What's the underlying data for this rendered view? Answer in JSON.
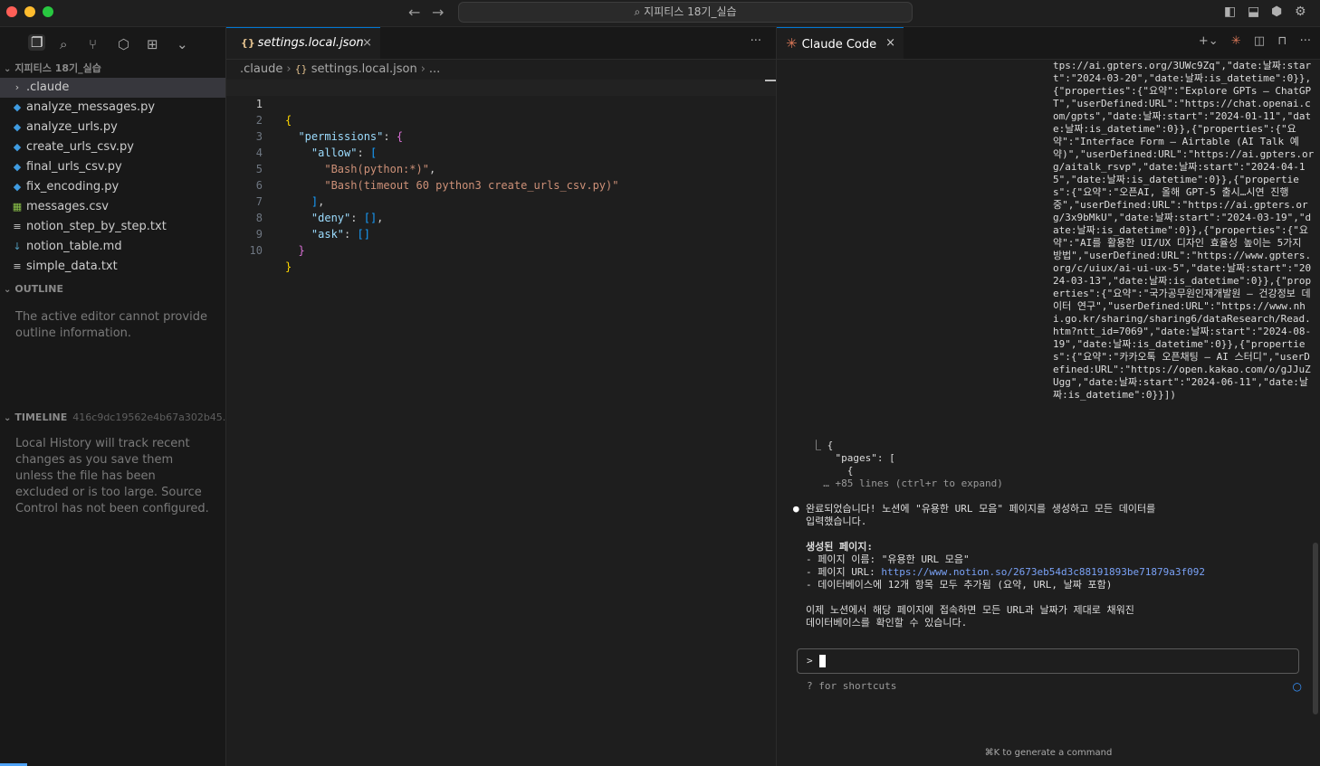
{
  "window": {
    "search_text": "지피티스 18기_실습"
  },
  "sidebar": {
    "explorer_title": "지피티스 18기_실습",
    "files": [
      {
        "name": ".claude",
        "type": "folder"
      },
      {
        "name": "analyze_messages.py",
        "type": "py"
      },
      {
        "name": "analyze_urls.py",
        "type": "py"
      },
      {
        "name": "create_urls_csv.py",
        "type": "py"
      },
      {
        "name": "final_urls_csv.py",
        "type": "py"
      },
      {
        "name": "fix_encoding.py",
        "type": "py"
      },
      {
        "name": "messages.csv",
        "type": "csv"
      },
      {
        "name": "notion_step_by_step.txt",
        "type": "txt"
      },
      {
        "name": "notion_table.md",
        "type": "md"
      },
      {
        "name": "simple_data.txt",
        "type": "txt"
      }
    ],
    "outline_title": "OUTLINE",
    "outline_message": "The active editor cannot provide outline information.",
    "timeline_title": "TIMELINE",
    "timeline_hash": "416c9dc19562e4b67a302b45...",
    "timeline_message": "Local History will track recent changes as you save them unless the file has been excluded or is too large. Source Control has not been configured."
  },
  "editor": {
    "tab_label": "settings.local.json",
    "breadcrumb": {
      "folder": ".claude",
      "file": "settings.local.json",
      "more": "..."
    },
    "lines": [
      "{",
      "  \"permissions\": {",
      "    \"allow\": [",
      "      \"Bash(python:*)\",",
      "      \"Bash(timeout 60 python3 create_urls_csv.py)\"",
      "    ],",
      "    \"deny\": [],",
      "    \"ask\": []",
      "  }",
      "}"
    ],
    "line_numbers": [
      "1",
      "2",
      "3",
      "4",
      "5",
      "6",
      "7",
      "8",
      "9",
      "10"
    ],
    "code": {
      "l2_key": "\"permissions\"",
      "l3_key": "\"allow\"",
      "l4_str": "\"Bash(python:*)\"",
      "l5_str": "\"Bash(timeout 60 python3 create_urls_csv.py)\"",
      "l7_key": "\"deny\"",
      "l8_key": "\"ask\""
    }
  },
  "claude": {
    "tab_label": "Claude Code",
    "json_dump": "tps://ai.gpters.org/3UWc9Zq\",\"date:날짜:start\":\"2024-03-20\",\"date:날짜:is_datetime\":0}},{\"properties\":{\"요약\":\"Explore GPTs – ChatGPT\",\"userDefined:URL\":\"https://chat.openai.com/gpts\",\"date:날짜:start\":\"2024-01-11\",\"date:날짜:is_datetime\":0}},{\"properties\":{\"요약\":\"Interface Form – Airtable (AI Talk 예약)\",\"userDefined:URL\":\"https://ai.gpters.org/aitalk_rsvp\",\"date:날짜:start\":\"2024-04-15\",\"date:날짜:is_datetime\":0}},{\"properties\":{\"요약\":\"오픈AI, 올해 GPT-5 출시…시연 진행 중\",\"userDefined:URL\":\"https://ai.gpters.org/3x9bMkU\",\"date:날짜:start\":\"2024-03-19\",\"date:날짜:is_datetime\":0}},{\"properties\":{\"요약\":\"AI를 활용한 UI/UX 디자인 효율성 높이는 5가지 방법\",\"userDefined:URL\":\"https://www.gpters.org/c/uiux/ai-ui-ux-5\",\"date:날짜:start\":\"2024-03-13\",\"date:날짜:is_datetime\":0}},{\"properties\":{\"요약\":\"국가공무원인재개발원 – 건강정보 데이터 연구\",\"userDefined:URL\":\"https://www.nhi.go.kr/sharing/sharing6/dataResearch/Read.htm?ntt_id=7069\",\"date:날짜:start\":\"2024-08-19\",\"date:날짜:is_datetime\":0}},{\"properties\":{\"요약\":\"카카오톡 오픈채팅 – AI 스터디\",\"userDefined:URL\":\"https://open.kakao.com/o/gJJuZUgg\",\"date:날짜:start\":\"2024-06-11\",\"date:날짜:is_datetime\":0}}])",
    "result_line1": "⎿ {",
    "result_line2": "    \"pages\": [",
    "result_line3": "      {",
    "result_more": "  … +85 lines (ctrl+r to expand)",
    "message_intro": "완료되었습니다! 노션에 \"유용한 URL 모음\" 페이지를 생성하고 모든 데이터를\n입력했습니다.",
    "created_heading": "생성된 페이지:",
    "page_name_line": "- 페이지 이름: \"유용한 URL 모음\"",
    "page_url_prefix": "- 페이지 URL: ",
    "page_url": "https://www.notion.so/2673eb54d3c88191893be71879a3f092",
    "db_line": "- 데이터베이스에 12개 항목 모두 추가됨 (요약, URL, 날짜 포함)",
    "closing": "이제 노션에서 해당 페이지에 접속하면 모든 URL과 날짜가 제대로 채워진\n데이터베이스를 확인할 수 있습니다.",
    "prompt": ">",
    "shortcuts_hint": "? for shortcuts",
    "generate_hint": "⌘K to generate a command"
  },
  "colors": {
    "accent": "#0078d4",
    "claude_orange": "#d97757",
    "link": "#7aa2f7"
  }
}
